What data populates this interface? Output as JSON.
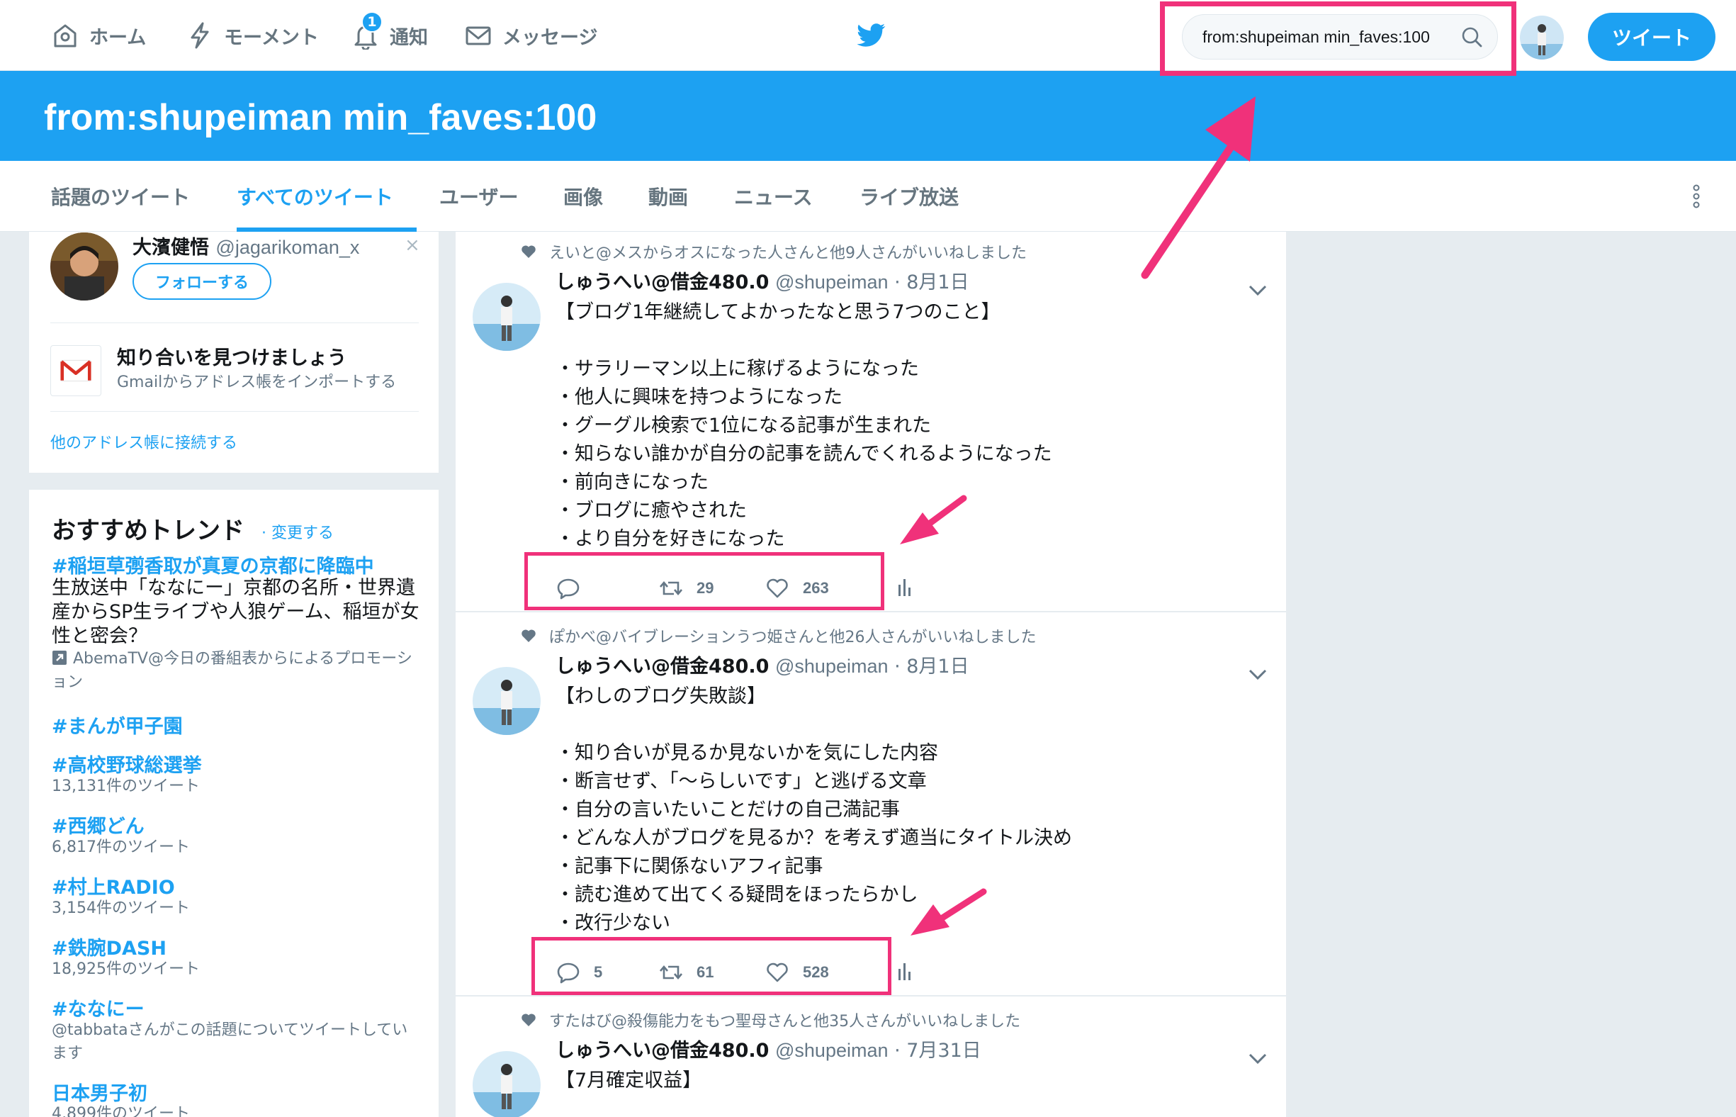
{
  "nav": {
    "home": "ホーム",
    "moments": "モーメント",
    "notifications": "通知",
    "notification_count": "1",
    "messages": "メッセージ",
    "search_value": "from:shupeiman min_faves:100",
    "tweet_button": "ツイート"
  },
  "query_title": "from:shupeiman min_faves:100",
  "tabs": [
    "話題のツイート",
    "すべてのツイート",
    "ユーザー",
    "画像",
    "動画",
    "ニュース",
    "ライブ放送"
  ],
  "active_tab": "すべてのツイート",
  "who_to_follow": {
    "name": "大濱健悟",
    "handle": "@jagarikoman_x",
    "follow_label": "フォローする",
    "dismiss": "×",
    "connect_title": "知り合いを見つけましょう",
    "connect_sub": "Gmailからアドレス帳をインポートする",
    "other_link": "他のアドレス帳に接続する"
  },
  "trends": {
    "title": "おすすめトレンド",
    "change": "· 変更する",
    "items": [
      {
        "tag": "#稲垣草彅香取が真夏の京都に降臨中",
        "desc": "生放送中「ななにー」京都の名所・世界遺産からSP生ライブや人狼ゲーム、稲垣が女性と密会？",
        "meta": "AbemaTV@今日の番組表からによるプロモーション"
      },
      {
        "tag": "#まんが甲子園",
        "meta": ""
      },
      {
        "tag": "#高校野球総選挙",
        "meta": "13,131件のツイート"
      },
      {
        "tag": "#西郷どん",
        "meta": "6,817件のツイート"
      },
      {
        "tag": "#村上RADIO",
        "meta": "3,154件のツイート"
      },
      {
        "tag": "#鉄腕DASH",
        "meta": "18,925件のツイート"
      },
      {
        "tag": "#ななにー",
        "meta": "@tabbataさんがこの話題についてツイートしています"
      },
      {
        "tag": "日本男子初",
        "meta": "4,899件のツイート"
      }
    ]
  },
  "tweets": [
    {
      "context": "えいと@メスからオスになった人さんと他9人さんがいいねしました",
      "name": "しゅうへい@借金480.0",
      "handle": "@shupeiman",
      "date": "· 8月1日",
      "body": "【ブログ1年継続してよかったなと思う7つのこと】\n\n・サラリーマン以上に稼げるようになった\n・他人に興味を持つようになった\n・グーグル検索で1位になる記事が生まれた\n・知らない誰かが自分の記事を読んでくれるようになった\n・前向きになった\n・ブログに癒やされた\n・より自分を好きになった",
      "replies": "",
      "retweets": "29",
      "likes": "263"
    },
    {
      "context": "ぽかべ@バイブレーションうつ姫さんと他26人さんがいいねしました",
      "name": "しゅうへい@借金480.0",
      "handle": "@shupeiman",
      "date": "· 8月1日",
      "body": "【わしのブログ失敗談】\n\n・知り合いが見るか見ないかを気にした内容\n・断言せず、「〜らしいです」と逃げる文章\n・自分の言いたいことだけの自己満記事\n・どんな人がブログを見るか？を考えず適当にタイトル決め\n・記事下に関係ないアフィ記事\n・読む進めて出てくる疑問をほったらかし\n・改行少ない",
      "replies": "5",
      "retweets": "61",
      "likes": "528"
    },
    {
      "context": "すたはび@殺傷能力をもつ聖母さんと他35人さんがいいねしました",
      "name": "しゅうへい@借金480.0",
      "handle": "@shupeiman",
      "date": "· 7月31日",
      "body": "【7月確定収益】",
      "replies": "",
      "retweets": "",
      "likes": ""
    }
  ],
  "colors": {
    "brand": "#1da1f2",
    "highlight": "#f0317a",
    "background": "#e6ecf0"
  }
}
